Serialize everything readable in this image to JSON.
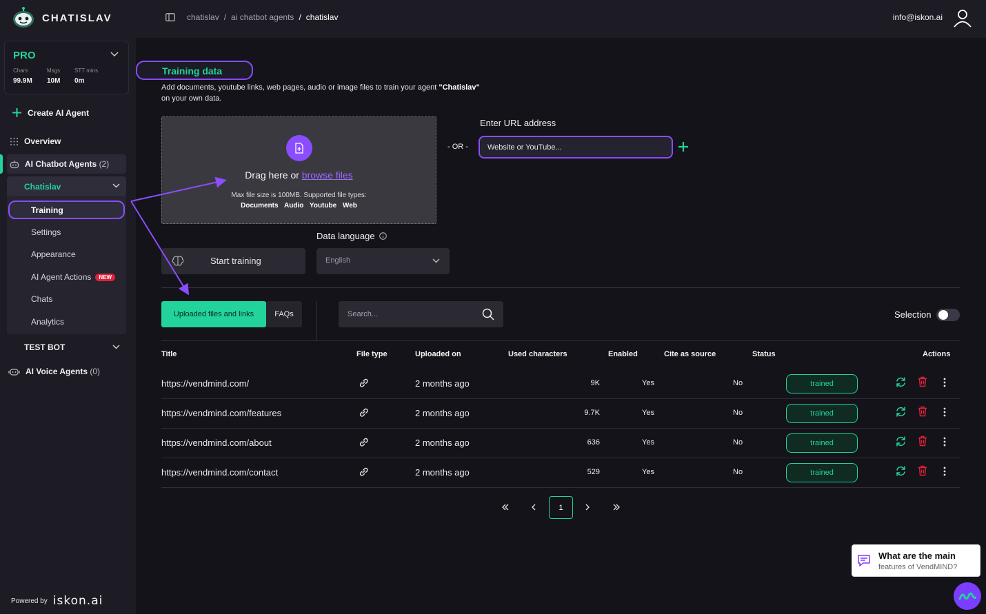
{
  "app": {
    "brand": "CHATISLAV",
    "powered_by": "Powered by",
    "powered_brand": "iskon.ai"
  },
  "plan": {
    "name": "PRO",
    "stats": [
      {
        "label": "Chars",
        "value": "99.9M"
      },
      {
        "label": "Msgs",
        "value": "10M"
      },
      {
        "label": "STT mins",
        "value": "0m"
      }
    ]
  },
  "sidebar": {
    "create": "Create AI Agent",
    "overview": "Overview",
    "chatbot_agents": "AI Chatbot Agents",
    "chatbot_agents_count": "(2)",
    "agent_name": "Chatislav",
    "sub_items": [
      "Training",
      "Settings",
      "Appearance",
      "AI Agent Actions",
      "Chats",
      "Analytics"
    ],
    "new_badge": "NEW",
    "test_bot": "TEST BOT",
    "voice_agents": "AI Voice Agents",
    "voice_agents_count": "(0)"
  },
  "topbar": {
    "breadcrumbs": [
      "chatislav",
      "ai chatbot agents",
      "chatislav"
    ],
    "email": "info@iskon.ai"
  },
  "training": {
    "title": "Training data",
    "desc_1": "Add documents, youtube links, web pages, audio or image files to train your agent ",
    "desc_agent": "\"Chatislav\"",
    "desc_2": "on your own data.",
    "drop_main": "Drag here or ",
    "drop_link": "browse files",
    "drop_sub": "Max file size is 100MB. Supported file types:",
    "drop_types": "Documents Audio Youtube Web",
    "or": "- OR -",
    "url_label": "Enter URL address",
    "url_placeholder": "Website or YouTube...",
    "start_training": "Start training",
    "lang_label": "Data language",
    "lang_value": "English"
  },
  "list": {
    "tabs": [
      "Uploaded files and links",
      "FAQs"
    ],
    "search_placeholder": "Search...",
    "selection_label": "Selection",
    "columns": [
      "Title",
      "File type",
      "Uploaded on",
      "Used characters",
      "Enabled",
      "Cite as source",
      "Status",
      "Actions"
    ],
    "rows": [
      {
        "title": "https://vendmind.com/",
        "uploaded": "2 months ago",
        "chars": "9K",
        "enabled": "Yes",
        "cite": "No",
        "status": "trained"
      },
      {
        "title": "https://vendmind.com/features",
        "uploaded": "2 months ago",
        "chars": "9.7K",
        "enabled": "Yes",
        "cite": "No",
        "status": "trained"
      },
      {
        "title": "https://vendmind.com/about",
        "uploaded": "2 months ago",
        "chars": "636",
        "enabled": "Yes",
        "cite": "No",
        "status": "trained"
      },
      {
        "title": "https://vendmind.com/contact",
        "uploaded": "2 months ago",
        "chars": "529",
        "enabled": "Yes",
        "cite": "No",
        "status": "trained"
      }
    ],
    "page": "1"
  },
  "chat_widget": {
    "line1": "What are the main",
    "line2": "features of VendMIND?"
  },
  "colors": {
    "accent": "#22d39b",
    "highlight": "#8a4dff",
    "danger": "#e2213a"
  }
}
